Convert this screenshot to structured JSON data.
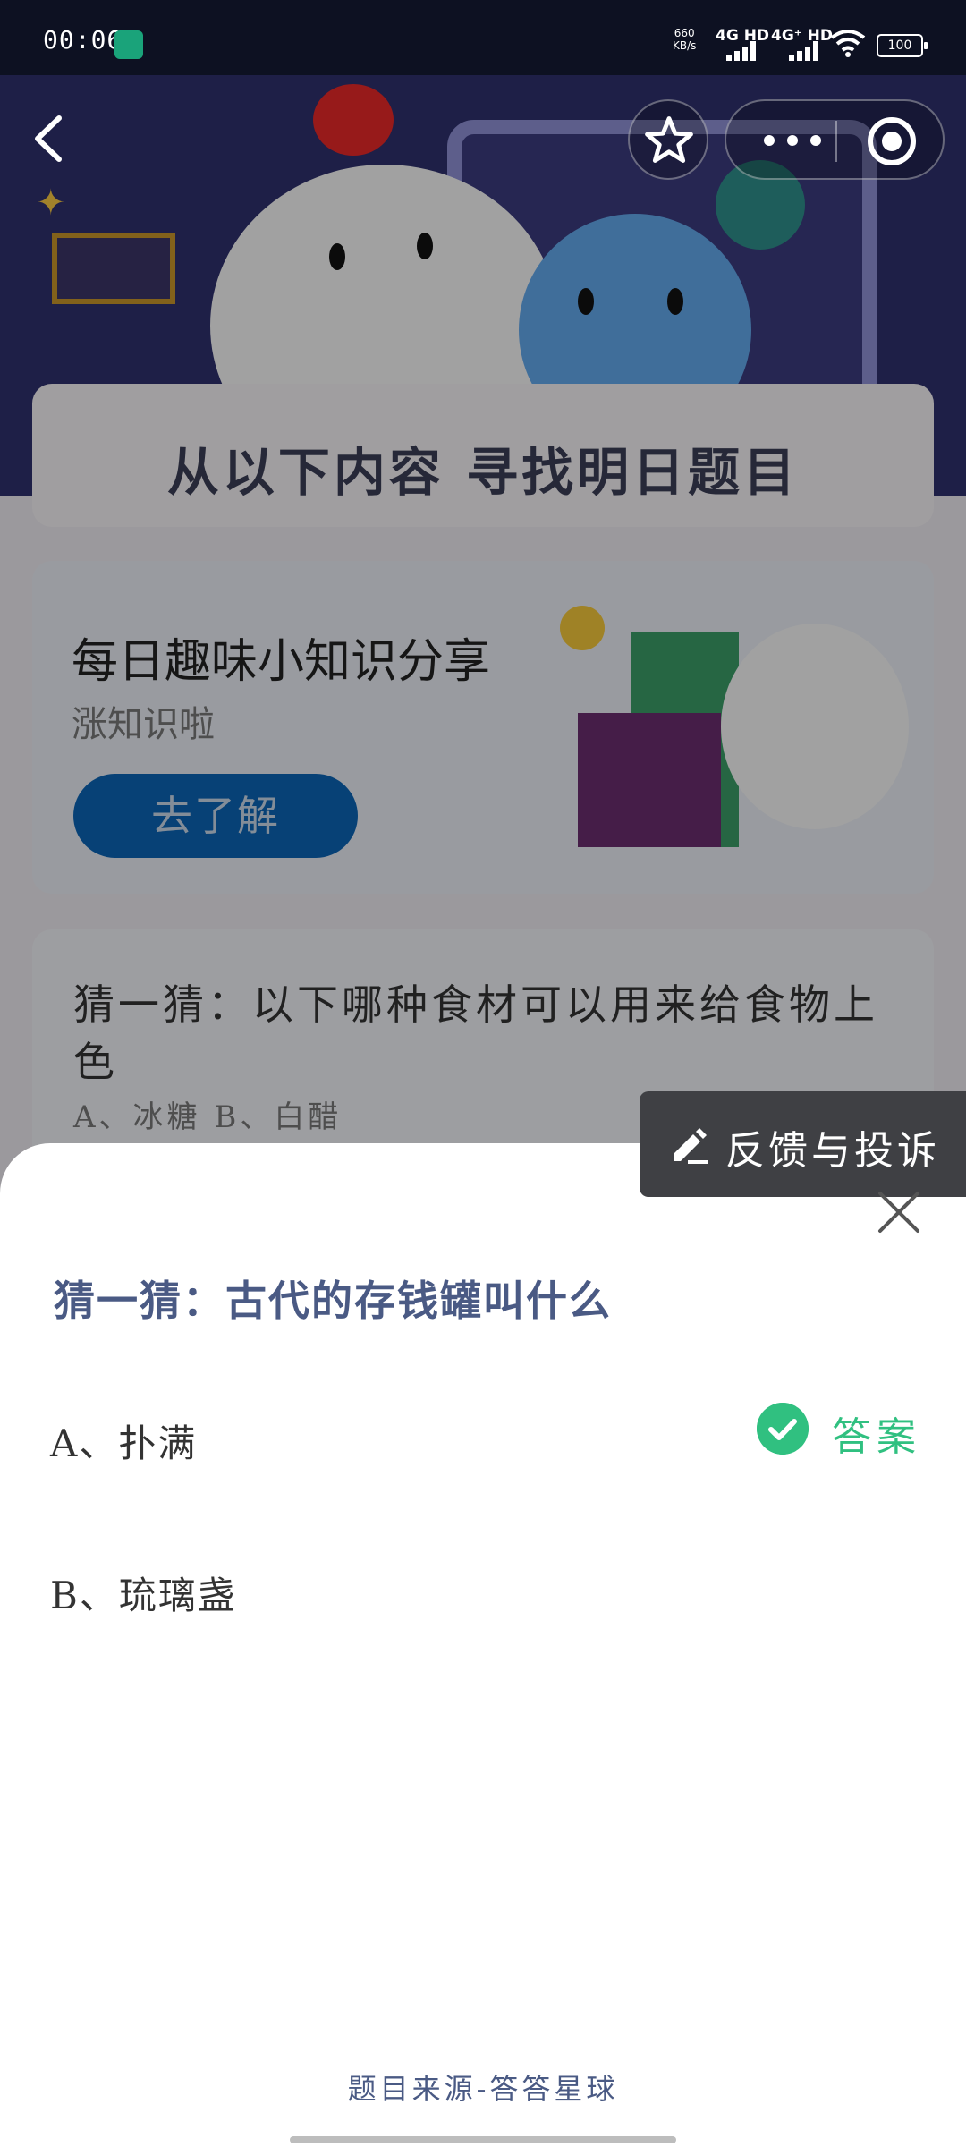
{
  "status_bar": {
    "time": "00:06",
    "speed_value": "660",
    "speed_unit": "KB/s",
    "network_1": "4G HD",
    "network_2": "4G⁺ HD",
    "battery": "100"
  },
  "background": {
    "banner_title": "从以下内容 寻找明日题目",
    "knowledge_card": {
      "title": "每日趣味小知识分享",
      "subtitle": "涨知识啦",
      "button_label": "去了解"
    },
    "quiz_preview": {
      "question": "猜一猜：以下哪种食材可以用来给食物上色",
      "options": "A、冰糖   B、白醋"
    }
  },
  "feedback_label": "反馈与投诉",
  "sheet": {
    "question": "猜一猜：古代的存钱罐叫什么",
    "options": [
      {
        "label": "A、扑满",
        "is_answer": true
      },
      {
        "label": "B、琉璃盏",
        "is_answer": false
      }
    ],
    "answer_label": "答案",
    "source": "题目来源-答答星球"
  },
  "colors": {
    "accent_green": "#30c080",
    "question_blue": "#4a5a84",
    "button_blue": "#0c63b3"
  }
}
